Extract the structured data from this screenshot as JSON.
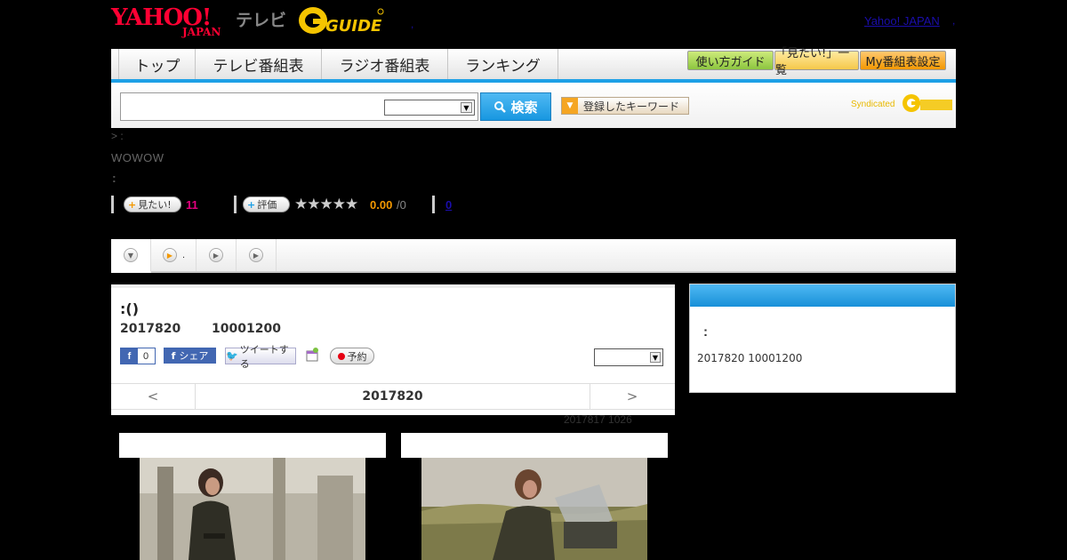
{
  "header": {
    "yahoo_logo": "YAHOO!",
    "japan_logo": "JAPAN",
    "tv_label": "テレビ",
    "gguide_logo": "GUIDE",
    "yahoo_japan_link": "Yahoo! JAPAN",
    "right_dot": ",",
    "mid_dot": ","
  },
  "nav": {
    "tabs": [
      "トップ",
      "テレビ番組表",
      "ラジオ番組表",
      "ランキング"
    ],
    "guide_buttons": [
      "使い方ガイド",
      "「見たい!」一覧",
      "My番組表設定"
    ],
    "accent": "#1ea0e6"
  },
  "search": {
    "placeholder": "",
    "select_value": "",
    "search_label": "検索",
    "keyword_label": "登録したキーワード",
    "syndicated_label": "Syndicated"
  },
  "program": {
    "breadcrumb": "> :",
    "station": "WOWOW",
    "colon": ":",
    "want_label": "見たい!",
    "want_count": "11",
    "rate_label": "評価",
    "stars": "★★★★★",
    "score": "0.00",
    "score_den": "/0",
    "comment_count": "0"
  },
  "tabstrip": {
    "tabs": [
      {
        "icon": "down-arrow-icon",
        "label": ""
      },
      {
        "icon": "play-icon",
        "label": "."
      },
      {
        "icon": "play-icon",
        "label": ""
      },
      {
        "icon": "play-icon",
        "label": ""
      }
    ]
  },
  "main": {
    "title": ":()",
    "date": "2017820",
    "time": "10001200",
    "fb_like_count": "0",
    "fb_share_label": "シェア",
    "tweet_label": "ツイートする",
    "reserve_label": "予約",
    "share_select_value": "",
    "prev_label": "<",
    "next_label": ">",
    "nav_date": "2017820",
    "updated": "2017817  1026"
  },
  "side": {
    "colon": ":",
    "info": "2017820  10001200"
  }
}
